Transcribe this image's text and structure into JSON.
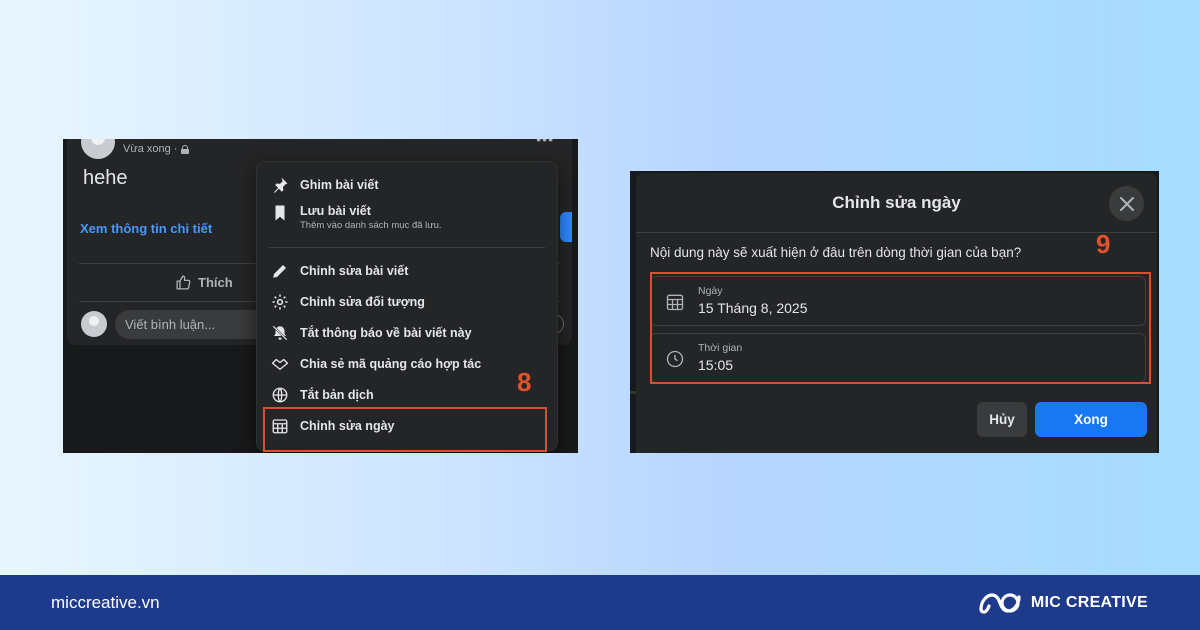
{
  "left_panel": {
    "post": {
      "status": "Vừa xong ·",
      "text": "hehe",
      "detail_link": "Xem thông tin chi tiết",
      "like_label": "Thích",
      "comment_placeholder": "Viết bình luận..."
    },
    "menu": {
      "items": [
        {
          "label": "Ghim bài viết",
          "icon": "pin-icon"
        },
        {
          "label": "Lưu bài viết",
          "sub": "Thêm vào danh sách mục đã lưu.",
          "icon": "bookmark-icon"
        },
        {
          "label": "Chỉnh sửa bài viết",
          "icon": "pencil-icon"
        },
        {
          "label": "Chỉnh sửa đối tượng",
          "icon": "gear-icon"
        },
        {
          "label": "Tắt thông báo về bài viết này",
          "icon": "bell-off-icon"
        },
        {
          "label": "Chia sẻ mã quảng cáo hợp tác",
          "icon": "handshake-icon"
        },
        {
          "label": "Tắt bản dịch",
          "icon": "globe-icon"
        },
        {
          "label": "Chỉnh sửa ngày",
          "icon": "calendar-icon"
        }
      ]
    },
    "step_label": "8"
  },
  "right_panel": {
    "dialog": {
      "title": "Chỉnh sửa ngày",
      "question": "Nội dung này sẽ xuất hiện ở đâu trên dòng thời gian của bạn?",
      "date_label": "Ngày",
      "date_value": "15 Tháng 8, 2025",
      "time_label": "Thời gian",
      "time_value": "15:05",
      "cancel_label": "Hủy",
      "done_label": "Xong"
    },
    "step_label": "9"
  },
  "footer": {
    "site": "miccreative.vn",
    "brand": "MIC CREATIVE"
  },
  "colors": {
    "accent_blue": "#1877f2",
    "highlight_red": "#d9502f",
    "footer_bg": "#1e3a8a"
  }
}
